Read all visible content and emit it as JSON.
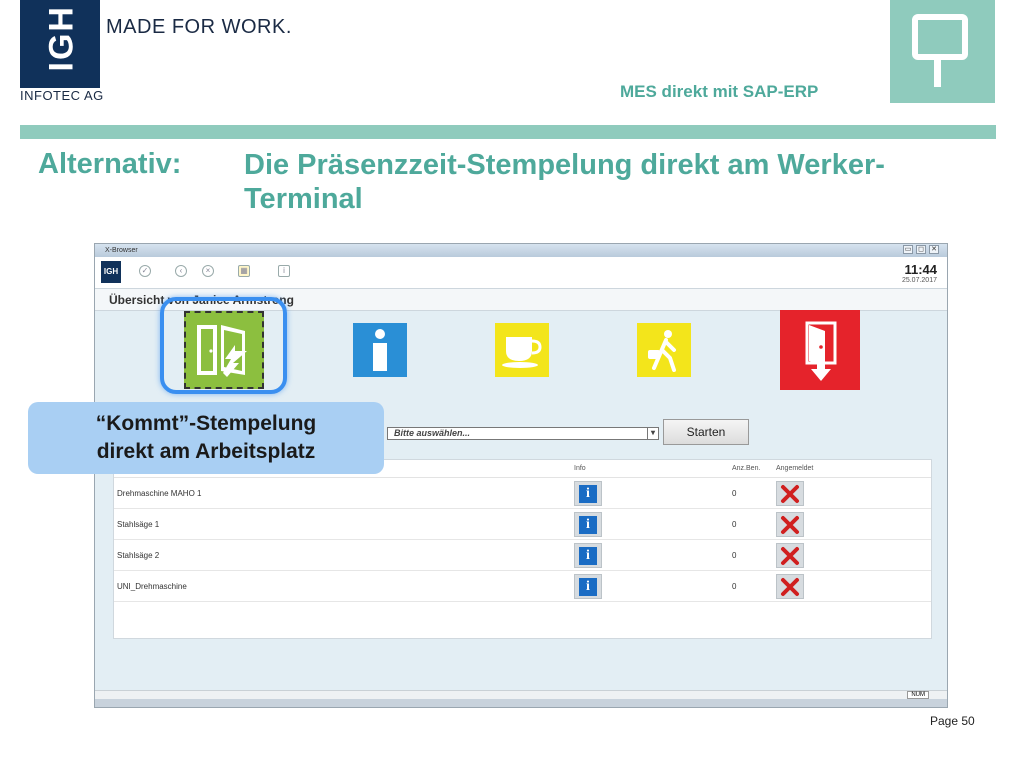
{
  "logo": {
    "initials": "IGH",
    "company": "INFOTEC AG",
    "slogan": "MADE FOR WORK."
  },
  "header": {
    "product": "MES direkt mit SAP-ERP",
    "icon": "terminal-sign-icon"
  },
  "heading": {
    "label": "Alternativ:",
    "text": "Die Präsenzzeit-Stempelung direkt am Werker-Terminal"
  },
  "browser": {
    "title": "X-Browser",
    "window_controls": [
      "▭",
      "◻",
      "✕"
    ],
    "time": "11:44",
    "date": "25.07.2017",
    "subtitle": "Übersicht von Janice Armstrong",
    "select_placeholder": "Bitte auswählen...",
    "start_label": "Starten",
    "table": {
      "headers": {
        "info": "Info",
        "count": "Anz.Ben.",
        "status": "Angemeldet"
      },
      "rows": [
        {
          "name": "Drehmaschine MAHO 1",
          "count": "0"
        },
        {
          "name": "Stahlsäge 1",
          "count": "0"
        },
        {
          "name": "Stahlsäge 2",
          "count": "0"
        },
        {
          "name": "UNI_Drehmaschine",
          "count": "0"
        }
      ]
    },
    "status_num": "NUM",
    "colors": {
      "kommt": "#8cbf3f",
      "info": "#2a8fd6",
      "pause": "#f3e51b",
      "geht": "#e5232b"
    }
  },
  "callout": {
    "line1": "“Kommt”-Stempelung",
    "line2": "direkt am Arbeitsplatz"
  },
  "page": {
    "label": "Page 50"
  }
}
